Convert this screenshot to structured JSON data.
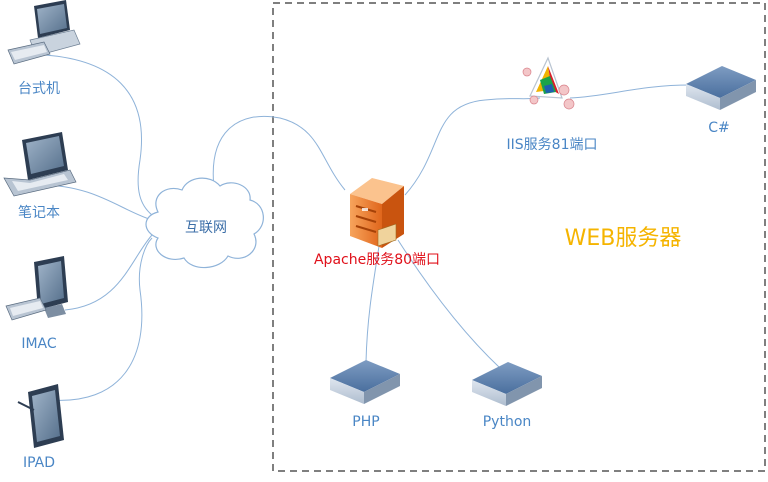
{
  "colors": {
    "label_blue": "#4a86c5",
    "apache_red": "#e0101a",
    "web_title": "#f5b400",
    "connector": "#8fb3d9",
    "boundary": "#555555"
  },
  "clients": {
    "desktop": {
      "label": "台式机",
      "icon": "desktop-computer-icon"
    },
    "laptop": {
      "label": "笔记本",
      "icon": "laptop-icon"
    },
    "imac": {
      "label": "IMAC",
      "icon": "imac-icon"
    },
    "ipad": {
      "label": "IPAD",
      "icon": "tablet-icon"
    }
  },
  "internet": {
    "label": "互联网",
    "icon": "cloud-icon"
  },
  "web_server_zone": {
    "title": "WEB服务器"
  },
  "servers": {
    "apache": {
      "label": "Apache服务80端口",
      "icon": "server-tower-icon"
    },
    "iis": {
      "label": "IIS服务81端口",
      "icon": "iis-logo-icon"
    },
    "csharp": {
      "label": "C#",
      "icon": "server-node-icon"
    },
    "php": {
      "label": "PHP",
      "icon": "server-node-icon"
    },
    "python": {
      "label": "Python",
      "icon": "server-node-icon"
    }
  }
}
